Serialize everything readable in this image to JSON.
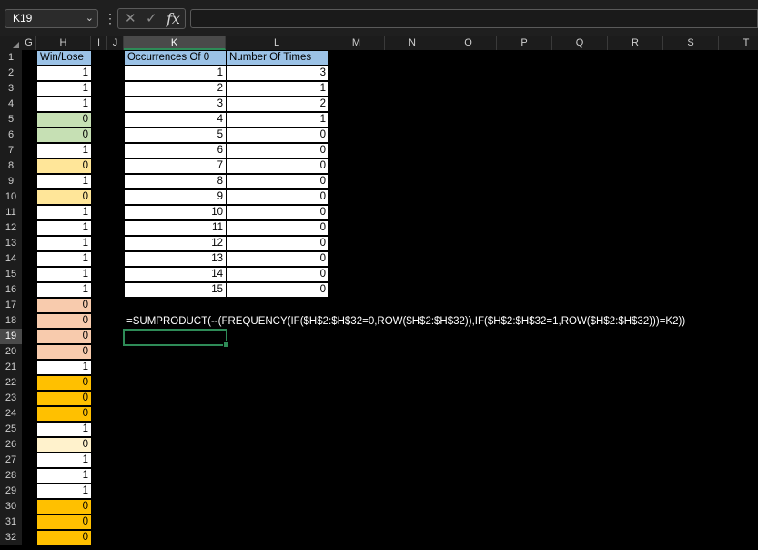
{
  "name_box": {
    "value": "K19"
  },
  "formula_bar": {
    "value": ""
  },
  "icons": {
    "cancel": "close-icon",
    "enter": "check-icon",
    "function": "fx-icon"
  },
  "column_headers": [
    "G",
    "H",
    "I",
    "J",
    "K",
    "L",
    "M",
    "N",
    "O",
    "P",
    "Q",
    "R",
    "S",
    "T"
  ],
  "selected_column": "K",
  "row_headers": [
    "1",
    "2",
    "3",
    "4",
    "5",
    "6",
    "7",
    "8",
    "9",
    "10",
    "11",
    "12",
    "13",
    "14",
    "15",
    "16",
    "17",
    "18",
    "19",
    "20",
    "21",
    "22",
    "23",
    "24",
    "25",
    "26",
    "27",
    "28",
    "29",
    "30",
    "31",
    "32"
  ],
  "selected_row": "19",
  "win_lose": {
    "header": "Win/Lose",
    "values": [
      "1",
      "1",
      "1",
      "0",
      "0",
      "1",
      "0",
      "1",
      "0",
      "1",
      "1",
      "1",
      "1",
      "1",
      "1",
      "0",
      "0",
      "0",
      "0",
      "1",
      "0",
      "0",
      "0",
      "1",
      "0",
      "1",
      "1",
      "1",
      "0",
      "0",
      "0"
    ],
    "fills": [
      "#ffffff",
      "#ffffff",
      "#ffffff",
      "#c6e0b4",
      "#c6e0b4",
      "#ffffff",
      "#ffe699",
      "#ffffff",
      "#ffe699",
      "#ffffff",
      "#ffffff",
      "#ffffff",
      "#ffffff",
      "#ffffff",
      "#ffffff",
      "#f8cbad",
      "#f8cbad",
      "#f8cbad",
      "#f8cbad",
      "#ffffff",
      "#ffc000",
      "#ffc000",
      "#ffc000",
      "#ffffff",
      "#fff2cc",
      "#ffffff",
      "#ffffff",
      "#ffffff",
      "#ffc000",
      "#ffc000",
      "#ffc000"
    ]
  },
  "occurrences_table": {
    "headers": [
      "Occurrences Of 0",
      "Number Of Times"
    ],
    "rows": [
      [
        "1",
        "3"
      ],
      [
        "2",
        "1"
      ],
      [
        "3",
        "2"
      ],
      [
        "4",
        "1"
      ],
      [
        "5",
        "0"
      ],
      [
        "6",
        "0"
      ],
      [
        "7",
        "0"
      ],
      [
        "8",
        "0"
      ],
      [
        "9",
        "0"
      ],
      [
        "10",
        "0"
      ],
      [
        "11",
        "0"
      ],
      [
        "12",
        "0"
      ],
      [
        "13",
        "0"
      ],
      [
        "14",
        "0"
      ],
      [
        "15",
        "0"
      ]
    ]
  },
  "formula_display": "=SUMPRODUCT(--(FREQUENCY(IF($H$2:$H$32=0,ROW($H$2:$H$32)),IF($H$2:$H$32=1,ROW($H$2:$H$32)))=K2))",
  "colors": {
    "header_fill": "#9bc2e6",
    "selection": "#2e8b57"
  }
}
